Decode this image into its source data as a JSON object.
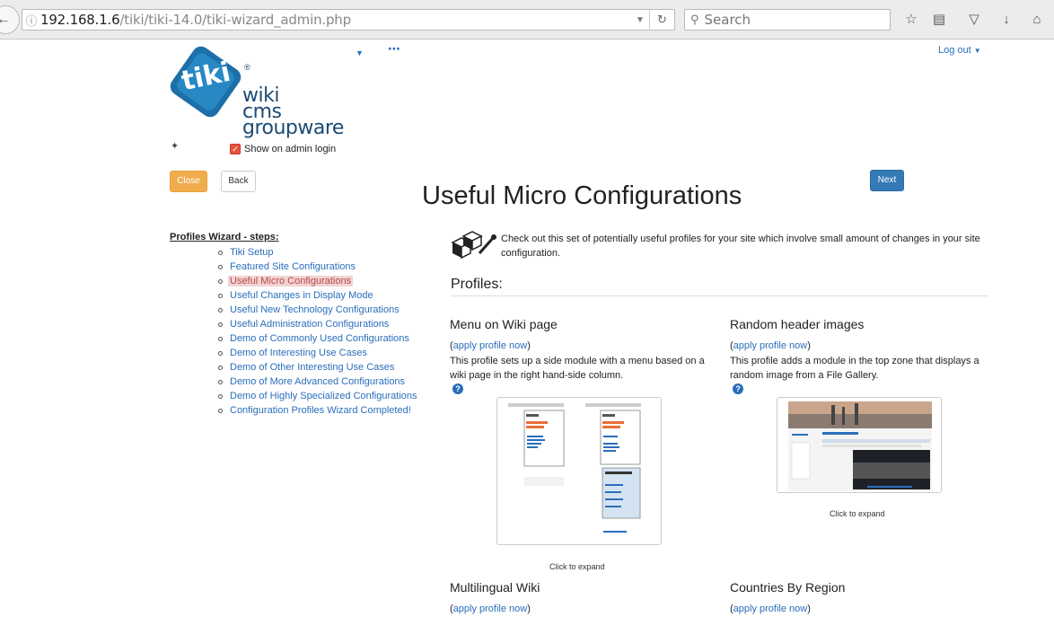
{
  "browser": {
    "url_host": "192.168.1.6",
    "url_path": "/tiki/tiki-14.0/tiki-wizard_admin.php",
    "search_placeholder": "Search"
  },
  "header": {
    "logo_text_1": "wiki",
    "logo_text_2": "cms",
    "logo_text_3": "groupware",
    "logo_mark": "tiki",
    "logout_label": "Log out",
    "show_on_login_label": "Show on admin login"
  },
  "buttons": {
    "close": "Close",
    "back": "Back",
    "next": "Next"
  },
  "page_title": "Useful Micro Configurations",
  "steps": {
    "title": "Profiles Wizard - steps:",
    "items": [
      "Tiki Setup",
      "Featured Site Configurations",
      "Useful Micro Configurations",
      "Useful Changes in Display Mode",
      "Useful New Technology Configurations",
      "Useful Administration Configurations",
      "Demo of Commonly Used Configurations",
      "Demo of Interesting Use Cases",
      "Demo of Other Interesting Use Cases",
      "Demo of More Advanced Configurations",
      "Demo of Highly Specialized Configurations",
      "Configuration Profiles Wizard Completed!"
    ],
    "active_index": 2
  },
  "intro": "Check out this set of potentially useful profiles for your site which involve small amount of changes in your site configuration.",
  "profiles_heading": "Profiles:",
  "cards": [
    {
      "title": "Menu on Wiki page",
      "apply": "apply profile now",
      "desc": "This profile sets up a side module with a menu based on a wiki page in the right hand-side column.",
      "expand": "Click to expand"
    },
    {
      "title": "Random header images",
      "apply": "apply profile now",
      "desc": "This profile adds a module in the top zone that displays a random image from a File Gallery.",
      "expand": "Click to expand"
    },
    {
      "title": "Multilingual Wiki",
      "apply": "apply profile now"
    },
    {
      "title": "Countries By Region",
      "apply": "apply profile now"
    }
  ],
  "colors": {
    "link": "#2a6ebb",
    "close_button": "#f0ad4e",
    "next_button": "#337ab7",
    "active_step_bg": "#f2d3d3",
    "logo_blue": "#1d4b73"
  }
}
